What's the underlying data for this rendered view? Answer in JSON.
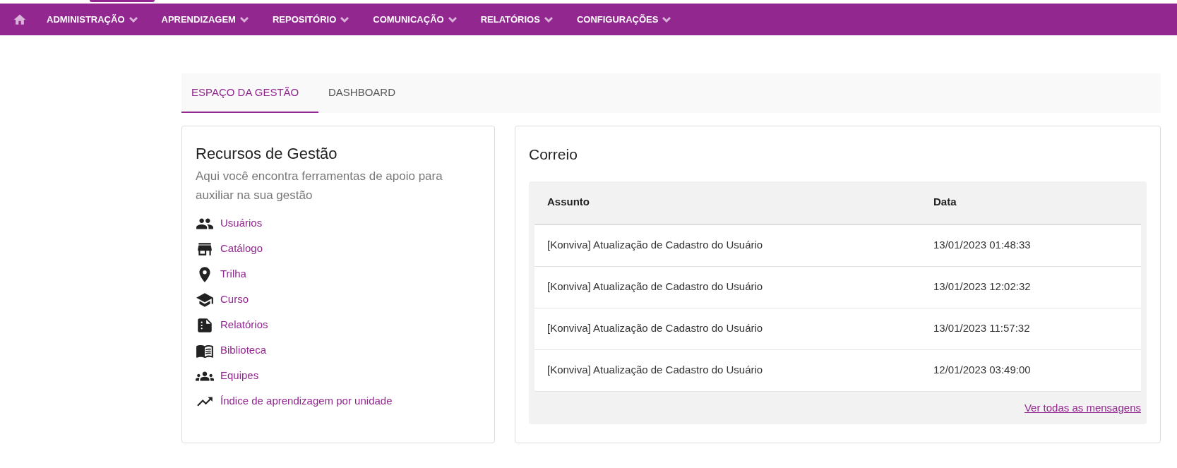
{
  "nav": {
    "items": [
      {
        "label": "ADMINISTRAÇÃO"
      },
      {
        "label": "APRENDIZAGEM"
      },
      {
        "label": "REPOSITÓRIO"
      },
      {
        "label": "COMUNICAÇÃO"
      },
      {
        "label": "RELATÓRIOS"
      },
      {
        "label": "CONFIGURAÇÕES"
      }
    ]
  },
  "tabs": [
    {
      "label": "ESPAÇO DA GESTÃO",
      "selected": true
    },
    {
      "label": "DASHBOARD",
      "selected": false
    }
  ],
  "resources": {
    "title": "Recursos de Gestão",
    "subtitle": "Aqui você encontra ferramentas de apoio para auxiliar na sua gestão",
    "links": [
      {
        "label": "Usuários"
      },
      {
        "label": "Catálogo"
      },
      {
        "label": "Trilha"
      },
      {
        "label": "Curso"
      },
      {
        "label": "Relatórios"
      },
      {
        "label": "Biblioteca"
      },
      {
        "label": "Equipes"
      },
      {
        "label": "Índice de aprendizagem por unidade"
      }
    ]
  },
  "mail": {
    "title": "Correio",
    "columns": [
      "Assunto",
      "Data"
    ],
    "rows": [
      [
        "[Konviva] Atualização de Cadastro do Usuário",
        "13/01/2023 01:48:33"
      ],
      [
        "[Konviva] Atualização de Cadastro do Usuário",
        "13/01/2023 12:02:32"
      ],
      [
        "[Konviva] Atualização de Cadastro do Usuário",
        "13/01/2023 11:57:32"
      ],
      [
        "[Konviva] Atualização de Cadastro do Usuário",
        "12/01/2023 03:49:00"
      ]
    ],
    "more_link": "Ver todas as mensagens"
  }
}
